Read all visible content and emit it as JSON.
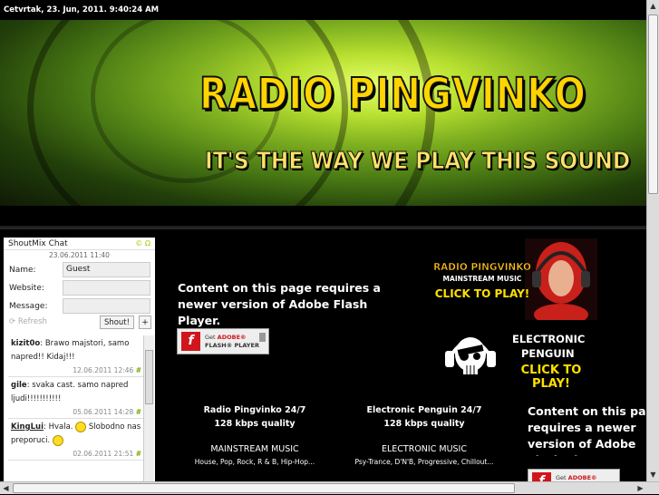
{
  "datetime": "Cetvrtak, 23. Jun, 2011. 9:40:24 AM",
  "banner": {
    "title": "RADIO PINGVINKO",
    "subtitle": "IT'S THE WAY WE PLAY THIS SOUND"
  },
  "chat": {
    "title": "ShoutMix Chat",
    "links": "© Ω",
    "date": "23.06.2011 11:40",
    "name_label": "Name:",
    "name_value": "Guest",
    "website_label": "Website:",
    "message_label": "Message:",
    "refresh_label": "Refresh",
    "shout_label": "Shout!",
    "plus_label": "+",
    "messages": [
      {
        "nick": "kizit0o",
        "text": "Brawo majstori, samo napred!! Kidaj!!!",
        "time": "12.06.2011 12:46"
      },
      {
        "nick": "gile",
        "text": "svaka cast. samo napred ljudi!!!!!!!!!!!",
        "time": "05.06.2011 14:28"
      },
      {
        "nick": "KingLui",
        "text_a": "Hvala.",
        "text_b": "Slobodno nas preporuci.",
        "time": "02.06.2011 21:51"
      }
    ],
    "hash": "#"
  },
  "main": {
    "flash_msg": "Content on this page requires a newer version of Adobe Flash Player.",
    "flash_msg_right": "Content on this page requires a newer version of Adobe Flash Player.",
    "get_flash_1": "Get",
    "get_flash_adobe": "ADOBE®",
    "get_flash_2": "FLASH® PLAYER",
    "promo1": {
      "line1": "RADIO PINGVINKO",
      "line2": "MAINSTREAM MUSIC",
      "line3": "CLICK TO PLAY!"
    },
    "promo2": {
      "line1": "ELECTRONIC",
      "line2": "PENGUIN",
      "line3": "CLICK TO PLAY!"
    },
    "stations": [
      {
        "title": "Radio Pingvinko 24/7",
        "quality": "128 kbps quality",
        "genre": "MAINSTREAM MUSIC",
        "tags": "House, Pop, Rock, R & B, Hip-Hop..."
      },
      {
        "title": "Electronic Penguin 24/7",
        "quality": "128 kbps quality",
        "genre": "ELECTRONIC MUSIC",
        "tags": "Psy-Trance, D'N'B, Progressive, Chillout..."
      }
    ]
  }
}
